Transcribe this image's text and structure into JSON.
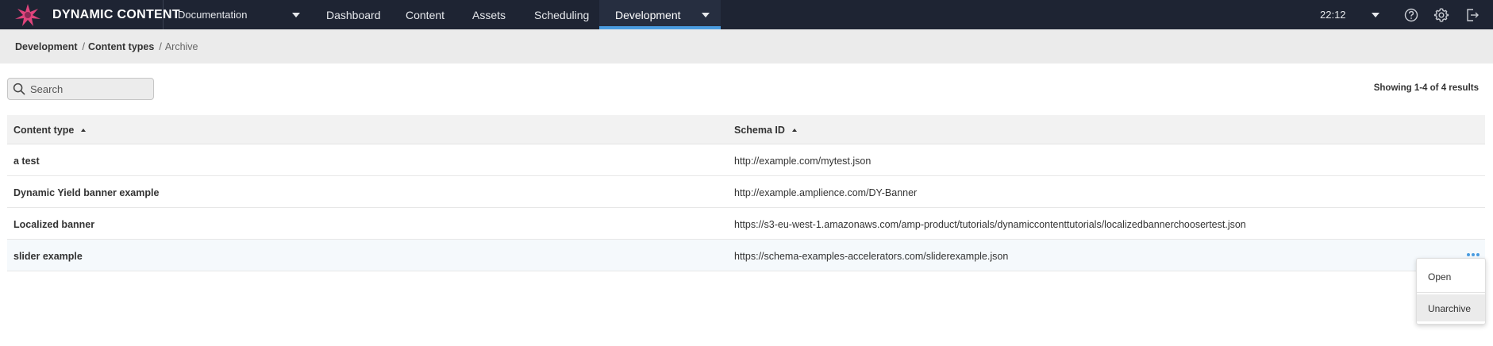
{
  "app": {
    "brand": "DYNAMIC CONTENT"
  },
  "header": {
    "hub_selector": "Documentation",
    "nav": [
      "Dashboard",
      "Content",
      "Assets",
      "Scheduling"
    ],
    "active_nav": "Development",
    "time": "22:12",
    "icons": [
      "help-icon",
      "settings-icon",
      "logout-icon"
    ]
  },
  "breadcrumb": {
    "items": [
      "Development",
      "Content types"
    ],
    "current": "Archive"
  },
  "search": {
    "placeholder": "Search",
    "value": ""
  },
  "results_text": "Showing 1-4 of 4 results",
  "table": {
    "columns": [
      "Content type",
      "Schema ID"
    ],
    "rows": [
      {
        "type": "a test",
        "schema": "http://example.com/mytest.json"
      },
      {
        "type": "Dynamic Yield banner example",
        "schema": "http://example.amplience.com/DY-Banner"
      },
      {
        "type": "Localized banner",
        "schema": "https://s3-eu-west-1.amazonaws.com/amp-product/tutorials/dynamiccontenttutorials/localizedbannerchoosertest.json"
      },
      {
        "type": "slider example",
        "schema": "https://schema-examples-accelerators.com/sliderexample.json"
      }
    ]
  },
  "context_menu": {
    "items": [
      "Open",
      "Unarchive"
    ]
  },
  "colors": {
    "topbar": "#1e2433",
    "accent": "#4a9ce0",
    "breadcrumb_bg": "#ebebeb",
    "logo_pink": "#e0447c"
  }
}
